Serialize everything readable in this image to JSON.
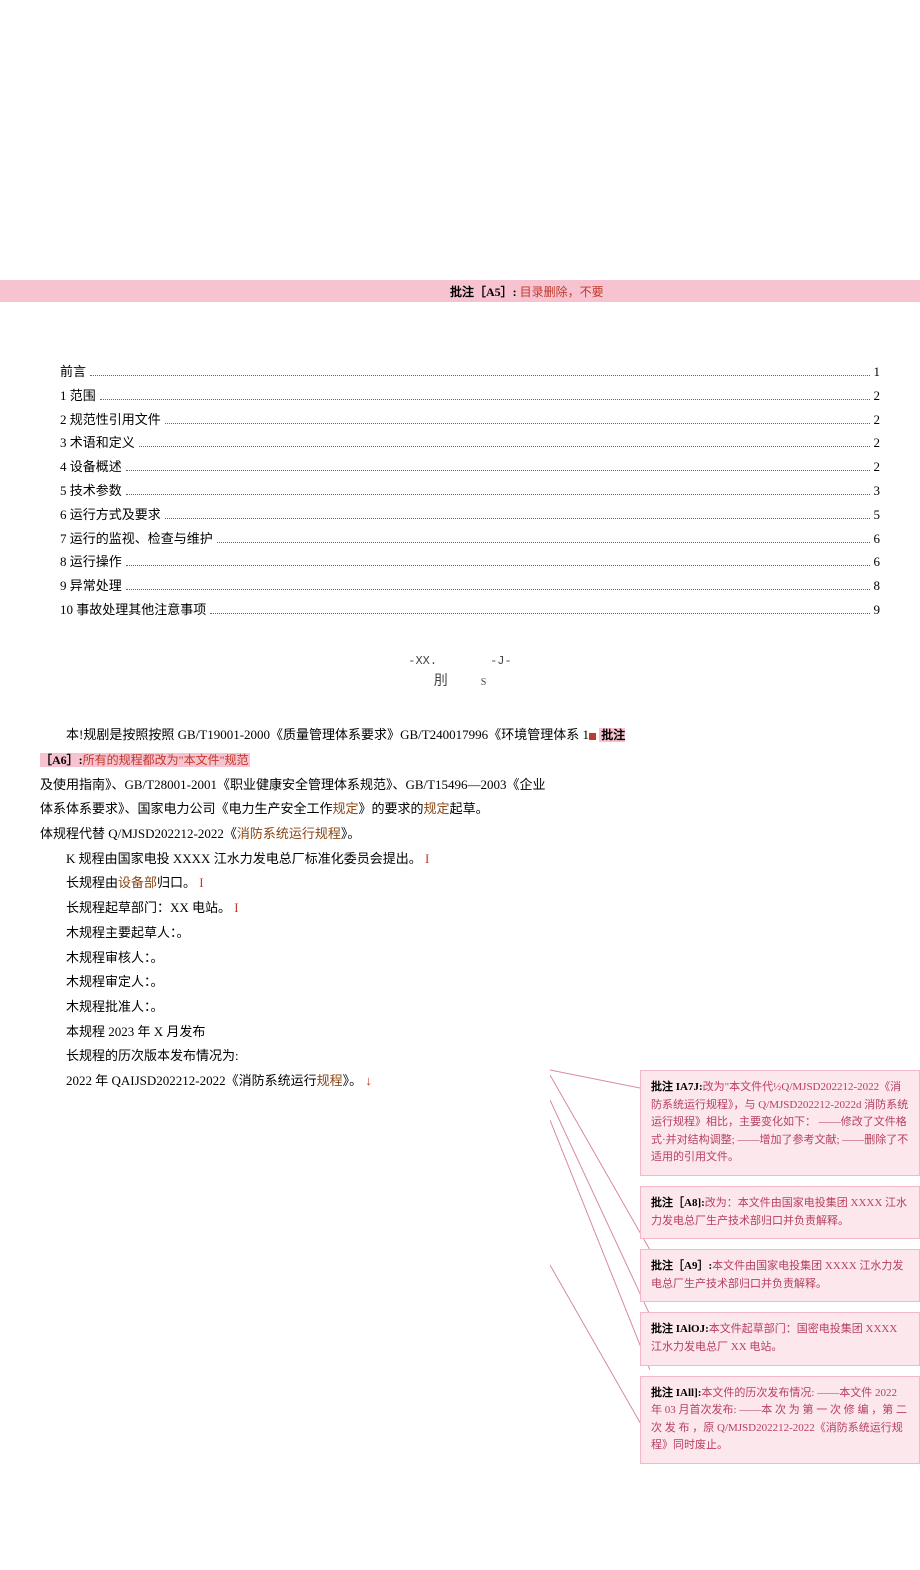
{
  "topComment": {
    "label": "批注［A5］:",
    "text": "目录删除，不要"
  },
  "toc": [
    {
      "label": "前言",
      "page": "1"
    },
    {
      "label": "1 范围",
      "page": "2"
    },
    {
      "label": "2 规范性引用文件",
      "page": "2"
    },
    {
      "label": "3 术语和定义",
      "page": "2"
    },
    {
      "label": "4 设备概述",
      "page": "2"
    },
    {
      "label": "5 技术参数",
      "page": "3"
    },
    {
      "label": "6 运行方式及要求",
      "page": "5"
    },
    {
      "label": "7 运行的监视、检查与维护",
      "page": "6"
    },
    {
      "label": "8 运行操作",
      "page": "6"
    },
    {
      "label": "9 异常处理",
      "page": "8"
    },
    {
      "label": "10 事故处理其他注意事项",
      "page": "9"
    }
  ],
  "centerMark": {
    "left": "-XX.",
    "mid": "刖",
    "right": "-J-",
    "sub": "S"
  },
  "body": {
    "p1_pre": "本!规剧是按照按照 ",
    "p1_gb1": "GB/T19001-2000",
    "p1_t1": "《质量管理体系要求》",
    "p1_gb2": "GB/T240017996",
    "p1_t2": "《环境管理体系 1",
    "a6_label": "批注［A6］:",
    "a6_text": "所有的规程都改为\"本文件\"规范",
    "p2": "及使用指南》、GB/T28001-2001《职业健康安全管理体系规范》、GB/T15496—2003《企业",
    "p3_pre": "体系体系要求》、国家电力公司《电力生产安全工作",
    "p3_mid": "规定",
    "p3_post": "》的要求的",
    "p3_end": "规定",
    "p3_qc": "起草。",
    "p4_pre": "体规程代替 Q/MJSD202212-2022《",
    "p4_mid": "消防系统运行规程",
    "p4_post": "》。",
    "li1": "K 规程由国家电投 XXXX 江水力发电总厂标准化委员会提出。",
    "li2_pre": "长规程由",
    "li2_mid": "设备部",
    "li2_post": "归口。",
    "li3": "长规程起草部门：XX 电站。",
    "li4": "木规程主要起草人：。",
    "li5": "木规程审核人：。",
    "li6": "木规程审定人：。",
    "li7": "木规程批准人：。",
    "li8": "本规程 2023 年 X 月发布",
    "li9": "长规程的历次版本发布情况为:",
    "li10_pre": "2022 年 QAIJSD202212-2022《消防系统运行",
    "li10_mid": "规程",
    "li10_post": "》。"
  },
  "comments": [
    {
      "head": "批注 IA7J:",
      "body": "改为\"本文件代½Q/MJSD202212-2022《消防系统运行规程》，与 Q/MJSD202212-2022d 消防系统运行规程》相比，主要变化如下：\n——修改了文件格式·并对结构调整;\n——增加了参考文献;\n——删除了不适用的引用文件。"
    },
    {
      "head": "批注［A8]:",
      "body": "改为：本文件由国家电投集团 XXXX 江水力发电总厂生产技术部归口并负责解释。"
    },
    {
      "head": "批注［A9］:",
      "body": "本文件由国家电投集团 XXXX 江水力发电总厂生产技术部归口并负责解释。"
    },
    {
      "head": "批注 IAlOJ:",
      "body": "本文件起草部门：国密电投集团 XXXX 江水力发电总厂 XX 电站。"
    },
    {
      "head": "批注 IAll]:",
      "body": "本文件的历次发布情况:\n\n——本文件 2022 年 03 月首次发布:\n——本 次 为 第 一 次 修 编 ，第 二 次 发 布 ，原 Q/MJSD202212-2022《消防系统运行规程》同时废止。"
    }
  ]
}
